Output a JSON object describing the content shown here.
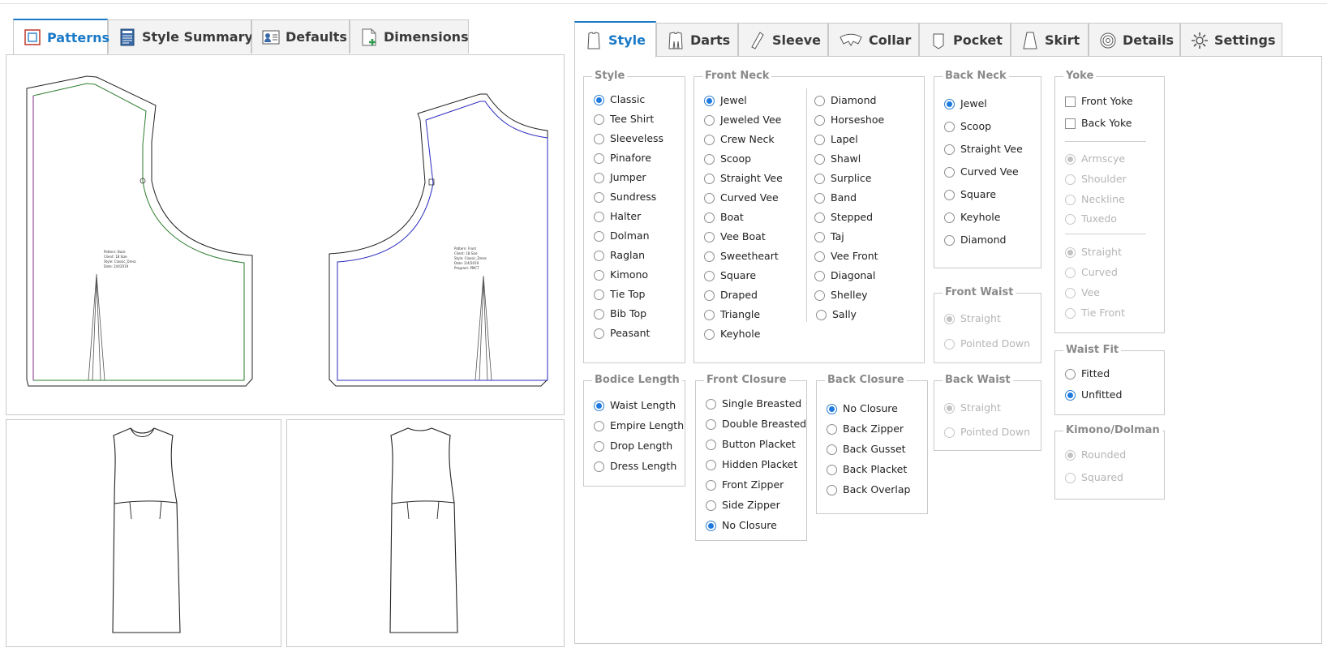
{
  "left_tabs": [
    {
      "label": "Patterns",
      "icon": "pattern-icon",
      "active": true
    },
    {
      "label": "Style Summary",
      "icon": "summary-icon",
      "active": false
    },
    {
      "label": "Defaults",
      "icon": "defaults-icon",
      "active": false
    },
    {
      "label": "Dimensions",
      "icon": "dimensions-icon",
      "active": false
    }
  ],
  "right_tabs": [
    {
      "label": "Style",
      "icon": "shirt-icon",
      "active": true
    },
    {
      "label": "Darts",
      "icon": "darts-icon",
      "active": false
    },
    {
      "label": "Sleeve",
      "icon": "sleeve-icon",
      "active": false
    },
    {
      "label": "Collar",
      "icon": "collar-icon",
      "active": false
    },
    {
      "label": "Pocket",
      "icon": "pocket-icon",
      "active": false
    },
    {
      "label": "Skirt",
      "icon": "skirt-icon",
      "active": false
    },
    {
      "label": "Details",
      "icon": "details-icon",
      "active": false
    },
    {
      "label": "Settings",
      "icon": "gear-icon",
      "active": false
    }
  ],
  "pattern_labels": {
    "front": [
      "Pattern: Back",
      "Client: 18 Size",
      "Style: Classic_Dress",
      "Date: 2/4/2019"
    ],
    "back": [
      "Pattern: Front",
      "Client: 18 Size",
      "Style: Classic_Dress",
      "Date: 2/4/2019",
      "Program: PMCT"
    ]
  },
  "groups": {
    "style": {
      "title": "Style",
      "options": [
        "Classic",
        "Tee Shirt",
        "Sleeveless",
        "Pinafore",
        "Jumper",
        "Sundress",
        "Halter",
        "Dolman",
        "Raglan",
        "Kimono",
        "Tie Top",
        "Bib Top",
        "Peasant"
      ],
      "selected": "Classic"
    },
    "front_neck": {
      "title": "Front Neck",
      "col1": [
        "Jewel",
        "Jeweled Vee",
        "Crew Neck",
        "Scoop",
        "Straight Vee",
        "Curved Vee",
        "Boat",
        "Vee Boat",
        "Sweetheart",
        "Square",
        "Draped",
        "Triangle",
        "Keyhole"
      ],
      "col2": [
        "Diamond",
        "Horseshoe",
        "Lapel",
        "Shawl",
        "Surplice",
        "Band",
        "Stepped",
        "Taj",
        "Vee Front",
        "Diagonal",
        "Shelley",
        "Sally"
      ],
      "selected": "Jewel"
    },
    "back_neck": {
      "title": "Back Neck",
      "options": [
        "Jewel",
        "Scoop",
        "Straight Vee",
        "Curved Vee",
        "Square",
        "Keyhole",
        "Diamond"
      ],
      "selected": "Jewel"
    },
    "yoke": {
      "title": "Yoke",
      "checks": [
        "Front Yoke",
        "Back Yoke"
      ],
      "set1": [
        "Armscye",
        "Shoulder",
        "Neckline",
        "Tuxedo"
      ],
      "set2": [
        "Straight",
        "Curved",
        "Vee",
        "Tie Front"
      ]
    },
    "front_waist": {
      "title": "Front Waist",
      "options": [
        "Straight",
        "Pointed Down"
      ]
    },
    "waist_fit": {
      "title": "Waist Fit",
      "options": [
        "Fitted",
        "Unfitted"
      ],
      "selected": "Unfitted"
    },
    "bodice_length": {
      "title": "Bodice Length",
      "options": [
        "Waist Length",
        "Empire Length",
        "Drop Length",
        "Dress Length"
      ],
      "selected": "Waist Length"
    },
    "front_closure": {
      "title": "Front Closure",
      "options": [
        "Single Breasted",
        "Double Breasted",
        "Button Placket",
        "Hidden Placket",
        "Front Zipper",
        "Side Zipper",
        "No Closure"
      ],
      "selected": "No Closure"
    },
    "back_closure": {
      "title": "Back Closure",
      "options": [
        "No Closure",
        "Back Zipper",
        "Back Gusset",
        "Back Placket",
        "Back Overlap"
      ],
      "selected": "No Closure"
    },
    "back_waist": {
      "title": "Back Waist",
      "options": [
        "Straight",
        "Pointed Down"
      ]
    },
    "kimono_dolman": {
      "title": "Kimono/Dolman",
      "options": [
        "Rounded",
        "Squared"
      ]
    }
  }
}
